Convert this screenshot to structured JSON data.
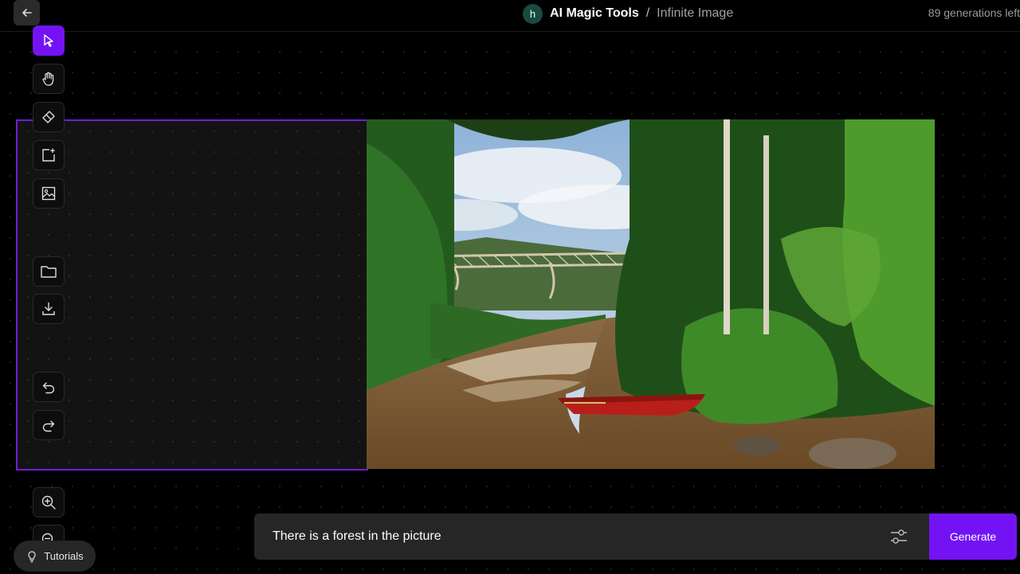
{
  "header": {
    "workspace_initial": "h",
    "app_name": "AI Magic Tools",
    "separator": "/",
    "page_name": "Infinite Image",
    "generations_left": "89 generations left"
  },
  "toolbar": {
    "tools": [
      {
        "name": "select",
        "icon": "cursor-icon",
        "active": true
      },
      {
        "name": "pan",
        "icon": "hand-icon",
        "active": false
      },
      {
        "name": "eraser",
        "icon": "eraser-icon",
        "active": false
      },
      {
        "name": "add-frame",
        "icon": "add-frame-icon",
        "active": false
      },
      {
        "name": "upload-image",
        "icon": "image-icon",
        "active": false
      },
      {
        "name": "open",
        "icon": "folder-icon",
        "active": false
      },
      {
        "name": "download",
        "icon": "download-icon",
        "active": false
      },
      {
        "name": "undo",
        "icon": "undo-icon",
        "active": false
      },
      {
        "name": "redo",
        "icon": "redo-icon",
        "active": false
      },
      {
        "name": "zoom-in",
        "icon": "zoom-in-icon",
        "active": false
      },
      {
        "name": "zoom-out",
        "icon": "zoom-out-icon",
        "active": false
      }
    ]
  },
  "canvas": {
    "frame_color": "#6d1fd6",
    "image_subject": "river-forest-bridge-boat-image"
  },
  "prompt": {
    "value": "There is a forest in the picture",
    "generate_label": "Generate"
  },
  "tutorials": {
    "label": "Tutorials"
  },
  "colors": {
    "accent": "#7313f4",
    "background": "#000000",
    "panel": "#262626"
  }
}
